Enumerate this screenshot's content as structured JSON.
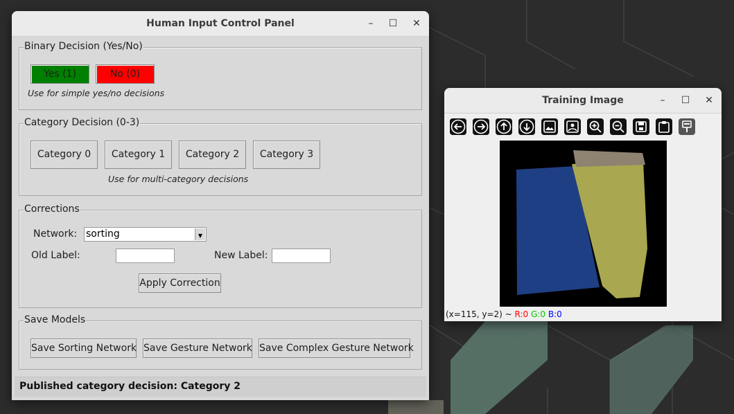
{
  "control_panel": {
    "title": "Human Input Control Panel",
    "binary": {
      "legend": "Binary Decision (Yes/No)",
      "yes_label": "Yes (1)",
      "no_label": "No (0)",
      "note": "Use for simple yes/no decisions",
      "yes_color": "#008000",
      "no_color": "#ff0000"
    },
    "category": {
      "legend": "Category Decision (0-3)",
      "buttons": [
        "Category 0",
        "Category 1",
        "Category 2",
        "Category 3"
      ],
      "note": "Use for multi-category decisions"
    },
    "corrections": {
      "legend": "Corrections",
      "network_label": "Network:",
      "network_value": "sorting",
      "old_label": "Old Label:",
      "old_value": "",
      "new_label": "New Label:",
      "new_value": "",
      "apply_label": "Apply Correction"
    },
    "save": {
      "legend": "Save Models",
      "buttons": [
        "Save Sorting Network",
        "Save Gesture Network",
        "Save Complex Gesture Network"
      ]
    },
    "status": "Published category decision: Category 2"
  },
  "image_window": {
    "title": "Training Image",
    "toolbar": [
      "back-icon",
      "forward-icon",
      "pan-icon",
      "down-icon",
      "image-icon",
      "image-settings-icon",
      "zoom-in-icon",
      "zoom-out-icon",
      "save-icon",
      "clipboard-icon",
      "stencil-icon"
    ],
    "coords_prefix": "(x=115, y=2) ~",
    "r": "R:0",
    "g": "G:0",
    "b": "B:0",
    "r_color": "#ff0000",
    "g_color": "#00cc00",
    "b_color": "#0000ff"
  }
}
